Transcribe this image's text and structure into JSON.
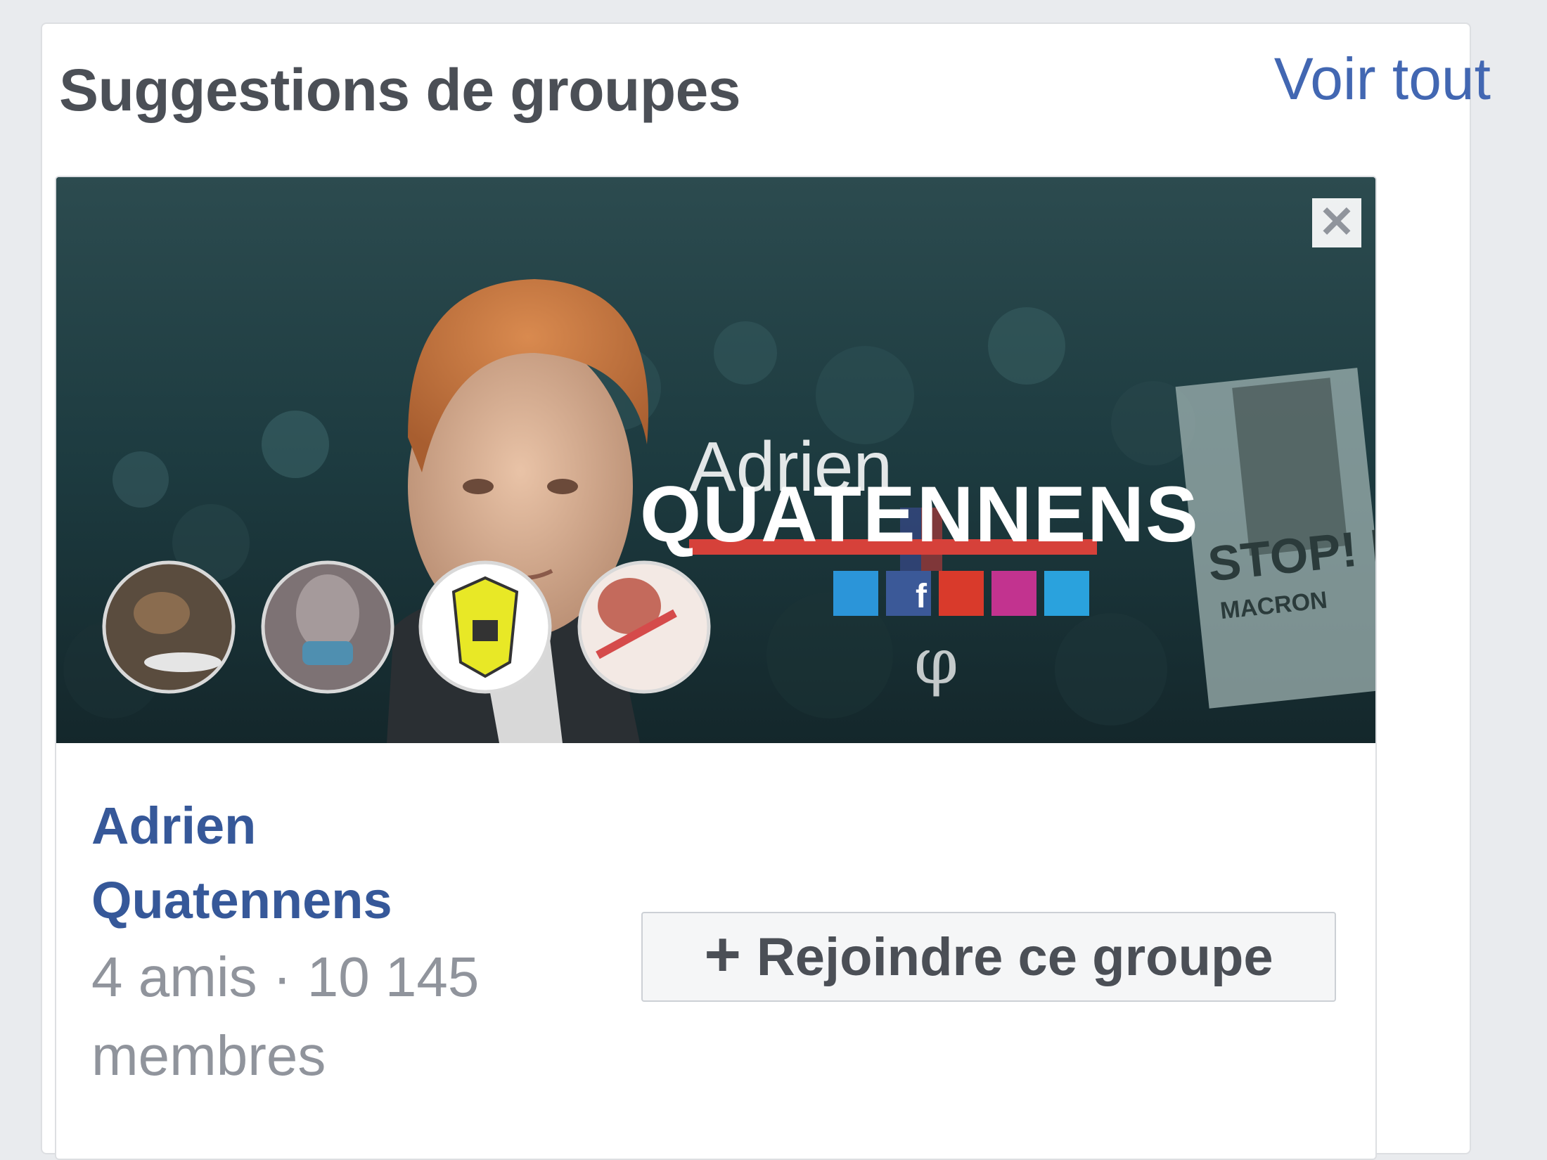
{
  "panel": {
    "title": "Suggestions de groupes",
    "see_all": "Voir tout"
  },
  "card": {
    "cover": {
      "name_first": "Adrien",
      "name_last": "QUATENNENS",
      "sign_text": "STOP! MACRON"
    },
    "close_glyph": "✕",
    "group_name_line1": "Adrien",
    "group_name_line2": "Quatennens",
    "meta_line1": "4 amis · 10 145",
    "meta_line2": "membres",
    "join_plus": "+",
    "join_label": "Rejoindre ce groupe"
  },
  "colors": {
    "link": "#4267b2",
    "group_name": "#365899",
    "muted": "#90949c",
    "title": "#4b4f56",
    "background": "#e9ebee"
  }
}
